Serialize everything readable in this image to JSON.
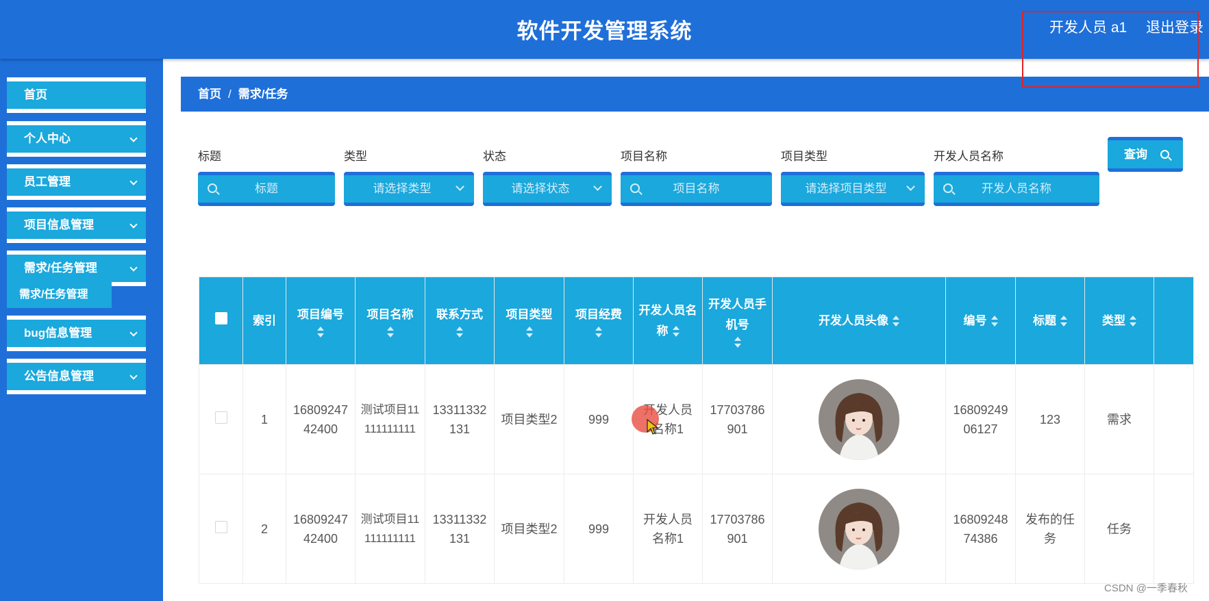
{
  "header": {
    "title": "软件开发管理系统",
    "user": "开发人员 a1",
    "logout": "退出登录"
  },
  "sidebar": {
    "items": [
      {
        "label": "首页"
      },
      {
        "label": "个人中心"
      },
      {
        "label": "员工管理"
      },
      {
        "label": "项目信息管理"
      },
      {
        "label": "需求/任务管理"
      },
      {
        "label": "bug信息管理"
      },
      {
        "label": "公告信息管理"
      }
    ],
    "sub_item": "需求/任务管理"
  },
  "breadcrumb": {
    "home": "首页",
    "sep": "/",
    "current": "需求/任务"
  },
  "search": {
    "fields": [
      {
        "label": "标题",
        "placeholder": "标题"
      },
      {
        "label": "类型",
        "placeholder": "请选择类型"
      },
      {
        "label": "状态",
        "placeholder": "请选择状态"
      },
      {
        "label": "项目名称",
        "placeholder": "项目名称"
      },
      {
        "label": "项目类型",
        "placeholder": "请选择项目类型"
      },
      {
        "label": "开发人员名称",
        "placeholder": "开发人员名称"
      }
    ],
    "query_button": "查询"
  },
  "table": {
    "headers": {
      "index": "索引",
      "project_no": "项目编号",
      "project_name": "项目名称",
      "contact": "联系方式",
      "project_type": "项目类型",
      "project_fee": "项目经费",
      "dev_name": "开发人员名称",
      "dev_phone": "开发人员手机号",
      "dev_avatar": "开发人员头像",
      "number": "编号",
      "title": "标题",
      "type": "类型"
    },
    "rows": [
      {
        "index": "1",
        "project_no": "1680924742400",
        "project_name": "测试项目11111111111",
        "contact": "13311332131",
        "project_type": "项目类型2",
        "project_fee": "999",
        "dev_name": "开发人员名称1",
        "dev_phone": "17703786901",
        "number": "1680924906127",
        "title": "123",
        "type": "需求"
      },
      {
        "index": "2",
        "project_no": "1680924742400",
        "project_name": "测试项目11111111111",
        "contact": "13311332131",
        "project_type": "项目类型2",
        "project_fee": "999",
        "dev_name": "开发人员名称1",
        "dev_phone": "17703786901",
        "number": "1680924874386",
        "title": "发布的任务",
        "type": "任务"
      }
    ]
  },
  "watermark": "CSDN @一季春秋",
  "colors": {
    "primary": "#1f6fd9",
    "accent": "#1aa8dd",
    "highlight": "#e02424"
  }
}
